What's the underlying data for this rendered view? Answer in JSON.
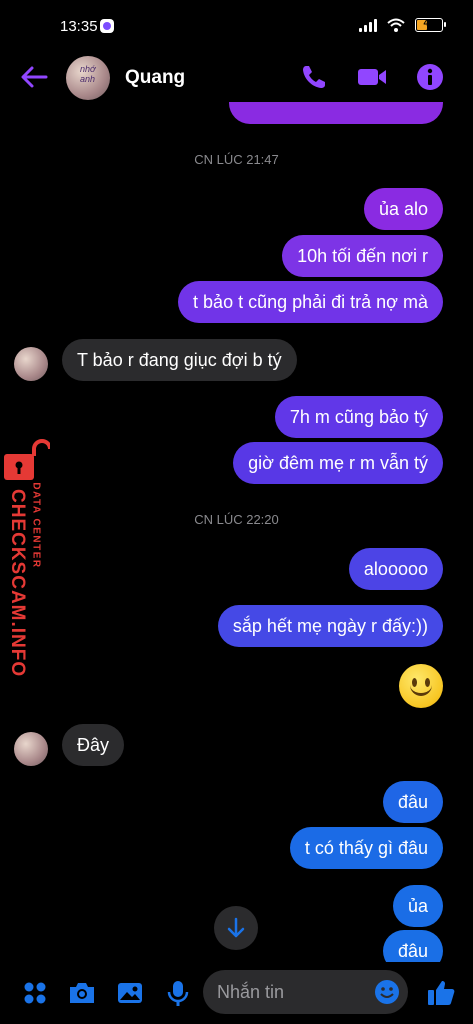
{
  "status_bar": {
    "time": "13:35",
    "battery": "44"
  },
  "header": {
    "contact_name": "Quang",
    "avatar_text": "nhớ anh"
  },
  "messages": [
    {
      "type": "timestamp",
      "text": "CN LÚC 21:47"
    },
    {
      "side": "out",
      "text": "ủa alo",
      "color": "#8a2be2"
    },
    {
      "side": "out",
      "text": "10h tối đến nơi r",
      "color": "#7d34e6"
    },
    {
      "side": "out",
      "text": "t bảo t cũng phải đi trả nợ mà",
      "color": "#7134e8"
    },
    {
      "side": "in",
      "text": "T bảo r đang giục đợi b tý"
    },
    {
      "side": "out",
      "text": "7h m cũng bảo tý",
      "color": "#6137e8"
    },
    {
      "side": "out",
      "text": "giờ đêm mẹ r m vẫn tý",
      "color": "#5838e6"
    },
    {
      "type": "timestamp",
      "text": "CN LÚC 22:20"
    },
    {
      "side": "out",
      "text": "alooooo",
      "color": "#4c44e6"
    },
    {
      "side": "out",
      "text": "sắp hết mẹ ngày r đấy:))",
      "color": "#4549e6"
    },
    {
      "side": "out",
      "emoji": "smile"
    },
    {
      "side": "in",
      "text": "Đây"
    },
    {
      "side": "out",
      "text": "đâu",
      "color": "#1f66e6"
    },
    {
      "side": "out",
      "text": "t có thấy gì đâu",
      "color": "#1b6be6"
    },
    {
      "side": "out",
      "text": "ủa",
      "color": "#1a6de6"
    },
    {
      "side": "out",
      "text": "đâu",
      "color": "#1a6fe6"
    }
  ],
  "composer": {
    "placeholder": "Nhắn tin"
  },
  "watermark": {
    "main": "CHECKSCAM.INFO",
    "sub": "DATA CENTER"
  },
  "colors": {
    "accent": "#9146ff",
    "blue": "#1a73e8",
    "incoming_bubble": "#2b2b2d"
  }
}
